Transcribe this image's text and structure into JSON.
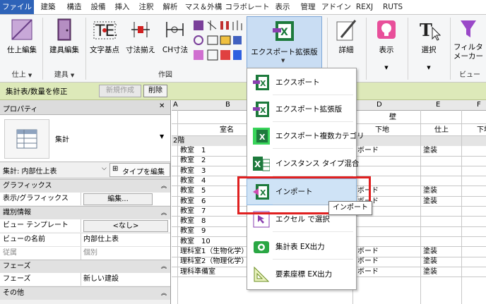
{
  "tabs": [
    {
      "label": "ファイル",
      "active": true
    },
    {
      "label": "建築"
    },
    {
      "label": "構造"
    },
    {
      "label": "設備"
    },
    {
      "label": "挿入"
    },
    {
      "label": "注釈"
    },
    {
      "label": "解析"
    },
    {
      "label": "マス＆外構"
    },
    {
      "label": "コラボレート"
    },
    {
      "label": "表示"
    },
    {
      "label": "管理"
    },
    {
      "label": "アドイン"
    },
    {
      "label": "REXJ"
    },
    {
      "label": "RUTS"
    }
  ],
  "ribbon": {
    "shiage_henshu": "仕上編集",
    "tategu_henshu": "建具編集",
    "moji_kiten": "文字基点",
    "sunpo_soroe": "寸法揃え",
    "ch_sunpo": "CH寸法",
    "export_ext": "エクスポート拡張版",
    "shosai": "詳細",
    "hyoji": "表示",
    "sentaku": "選択",
    "filter1": "フィルタ",
    "filter2": "メーカー",
    "grp_shiage": "仕上",
    "grp_tategu": "建具",
    "grp_sakuzu": "作図",
    "grp_view": "ビュー"
  },
  "context": {
    "title": "集計表/数量を修正",
    "new_btn": "新規作成",
    "delete_btn": "削除"
  },
  "properties": {
    "header": "プロパティ",
    "close": "✕",
    "type_name": "集計",
    "selector": "集計: 内部仕上表",
    "edit_type": "タイプを編集",
    "rows": [
      {
        "kind": "section",
        "label": "グラフィックス"
      },
      {
        "kind": "row",
        "label": "表示/グラフィックスの...",
        "value": "編集...",
        "button": true
      },
      {
        "kind": "section",
        "label": "識別情報"
      },
      {
        "kind": "row",
        "label": "ビュー テンプレート",
        "value": "<なし>",
        "button": true
      },
      {
        "kind": "row",
        "label": "ビューの名前",
        "value": "内部仕上表"
      },
      {
        "kind": "row",
        "label": "従属",
        "value": "個別",
        "grey": true
      },
      {
        "kind": "section",
        "label": "フェーズ"
      },
      {
        "kind": "row",
        "label": "フェーズ",
        "value": "新しい建設"
      },
      {
        "kind": "section",
        "label": "その他"
      }
    ]
  },
  "grid": {
    "col_letters": [
      "A",
      "B",
      "C",
      "D",
      "E",
      "F"
    ],
    "header_wall": "壁",
    "header_room": "室名",
    "header_base": "下地",
    "header_finish": "仕上",
    "header_f": "下地",
    "floor": "2階",
    "rows": [
      {
        "room": "教室　1",
        "base": "ボード",
        "finish": "塗装"
      },
      {
        "room": "教室　2",
        "base": "",
        "finish": ""
      },
      {
        "room": "教室　3",
        "base": "",
        "finish": ""
      },
      {
        "room": "教室　4",
        "base": "",
        "finish": ""
      },
      {
        "room": "教室　5",
        "base": "ボード",
        "finish": "塗装"
      },
      {
        "room": "教室　6",
        "base": "ボード",
        "finish": "塗装"
      },
      {
        "room": "教室　7",
        "base": "",
        "finish": ""
      },
      {
        "room": "教室　8",
        "base": "",
        "finish": ""
      },
      {
        "room": "教室　9",
        "base": "",
        "finish": ""
      },
      {
        "room": "教室　10",
        "base": "",
        "finish": ""
      },
      {
        "room": "理科室1（生物化学）",
        "base": "ボード",
        "finish": "塗装"
      },
      {
        "room": "理科室2（物理化学）",
        "base": "ボード",
        "finish": "塗装"
      },
      {
        "room": "理科準備室",
        "base": "ボード",
        "finish": "塗装"
      }
    ]
  },
  "dropdown": {
    "items": [
      {
        "label": "エクスポート",
        "icon": "excel-export-icon"
      },
      {
        "label": "エクスポート拡張版",
        "icon": "excel-export-ext-icon"
      },
      {
        "label": "エクスポート複数カテゴリ",
        "icon": "excel-multi-category-icon"
      },
      {
        "label": "インスタンス タイプ混合",
        "icon": "excel-instance-type-icon"
      },
      {
        "label": "インポート",
        "icon": "excel-import-icon"
      },
      {
        "label": "エクセル で選択",
        "icon": "cursor-select-icon"
      },
      {
        "label": "集計表 EX出力",
        "icon": "camera-icon"
      },
      {
        "label": "要素座標 EX出力",
        "icon": "triangle-ruler-icon"
      }
    ],
    "tooltip": "インポート"
  },
  "colors": {
    "tab_active": "#2e63b8",
    "context_bar": "#dde9b9",
    "highlight": "#e02020",
    "excel_green": "#1d7a3c"
  }
}
